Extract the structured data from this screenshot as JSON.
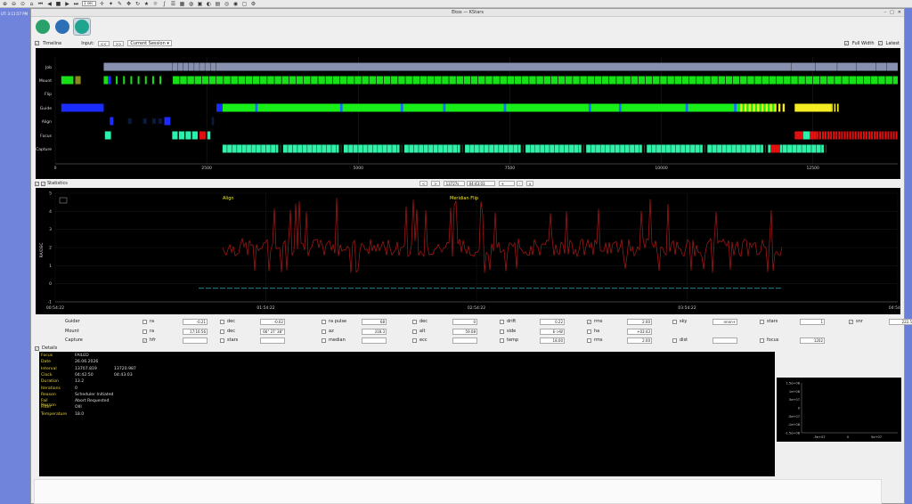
{
  "systray": {
    "zoom_box": "1 sec"
  },
  "desktop": {
    "clock": "UT: 3:11:57 PM"
  },
  "window": {
    "title": "Ekos — KStars"
  },
  "modules": [
    {
      "name": "scheduler-module",
      "color": "#2aa06a"
    },
    {
      "name": "analyze-module",
      "color": "#2d6fb5"
    },
    {
      "name": "capture-module",
      "color": "#1fa58f"
    }
  ],
  "timeline_bar": {
    "timeline_label": "Timeline",
    "input_label": "Input:",
    "prev_btn": "<<",
    "next_btn": ">>",
    "session": "Current Session",
    "fullwidth_label": "Full Width",
    "latest_label": "Latest"
  },
  "timeline": {
    "rows": [
      "Job",
      "Mount",
      "Flip",
      "Guide",
      "Align",
      "Focus",
      "Capture"
    ],
    "xticks": [
      "0",
      "2500",
      "5000",
      "7500",
      "10000",
      "12500"
    ],
    "xmax": 13900
  },
  "mid_bar": {
    "statistics_label": "Statistics",
    "left_btn": "<",
    "right_btn": ">",
    "time_value": "13727s",
    "clock_value": "04:43:03",
    "plus_btn": "+",
    "minus_btn": "-",
    "close_btn": "x"
  },
  "stats_plot": {
    "ylabel": "RA/DEC",
    "yticks": [
      "5",
      "4",
      "3",
      "2",
      "1",
      "0",
      "-1"
    ],
    "xticks": [
      "00:54:22",
      "01:54:22",
      "02:54:22",
      "03:54:22",
      "04:54:22"
    ],
    "label1": "Align",
    "label2": "Meridian Flip"
  },
  "stats": {
    "guider_label": "Guider",
    "mount_label": "Mount",
    "capture_label": "Capture",
    "guider": [
      {
        "label": "ra",
        "value": "-0.21"
      },
      {
        "label": "dec",
        "value": "-0.02"
      },
      {
        "label": "ra pulse",
        "value": "68"
      },
      {
        "label": "dec",
        "value": "0"
      },
      {
        "label": "drift",
        "value": "0.22"
      },
      {
        "label": "rms",
        "value": "2.00"
      },
      {
        "label": "sky",
        "value": "nnnn+"
      },
      {
        "label": "stars",
        "value": "1"
      },
      {
        "label": "snr",
        "value": "222.5"
      }
    ],
    "mount": [
      {
        "label": "ra",
        "value": "17:16:56"
      },
      {
        "label": "dec",
        "value": "66° 27' 38\""
      },
      {
        "label": "az",
        "value": "318.3"
      },
      {
        "label": "alt",
        "value": "59.08"
      },
      {
        "label": "side",
        "value": "E->W"
      },
      {
        "label": "ha",
        "value": "+03:43"
      }
    ],
    "capture": [
      {
        "label": "hfr",
        "value": ""
      },
      {
        "label": "stars",
        "value": ""
      },
      {
        "label": "median",
        "value": ""
      },
      {
        "label": "ecc",
        "value": ""
      },
      {
        "label": "temp",
        "value": "18.00"
      },
      {
        "label": "rms",
        "value": "2.00"
      },
      {
        "label": "dist",
        "value": ""
      },
      {
        "label": "focus",
        "value": "1202"
      }
    ]
  },
  "details": {
    "label": "Details",
    "rows": [
      {
        "k": "Focus",
        "v": "FAILED",
        "v2": ""
      },
      {
        "k": "Date",
        "v": "26.06.2026",
        "v2": ""
      },
      {
        "k": "Interval",
        "v": "13707.819",
        "v2": "13720.987"
      },
      {
        "k": "Clock",
        "v": "04:42:50",
        "v2": "04:43:03"
      },
      {
        "k": "Duration",
        "v": "13.2",
        "v2": ""
      },
      {
        "k": "Iterations",
        "v": "0",
        "v2": ""
      },
      {
        "k": "Reason",
        "v": "Scheduler Initiated",
        "v2": ""
      },
      {
        "k": "Fail Reason",
        "v": "Abort Requested",
        "v2": ""
      },
      {
        "k": "Filter",
        "v": "OIII",
        "v2": ""
      },
      {
        "k": "Temperature",
        "v": "18.0",
        "v2": ""
      }
    ]
  },
  "miniplot": {
    "yticks": [
      "1.5e+08",
      "1e+08",
      "5e+07",
      "0",
      "-5e+07",
      "-1e+08",
      "-1.5e+08"
    ],
    "xticks": [
      "-5e+07",
      "0",
      "5e+07"
    ]
  },
  "colors": {
    "job": "#8892b0",
    "mount": "#16e016",
    "guide": "#18ee18",
    "guide_blue": "#1a2cff",
    "align": "#1a2cff",
    "focus": "#2cf0b0",
    "focus_fail": "#e01010",
    "capture": "#32f0a8",
    "yellow": "#f4ec22",
    "stat_red": "#b01818",
    "stat_cyan": "#2bb3c8"
  }
}
